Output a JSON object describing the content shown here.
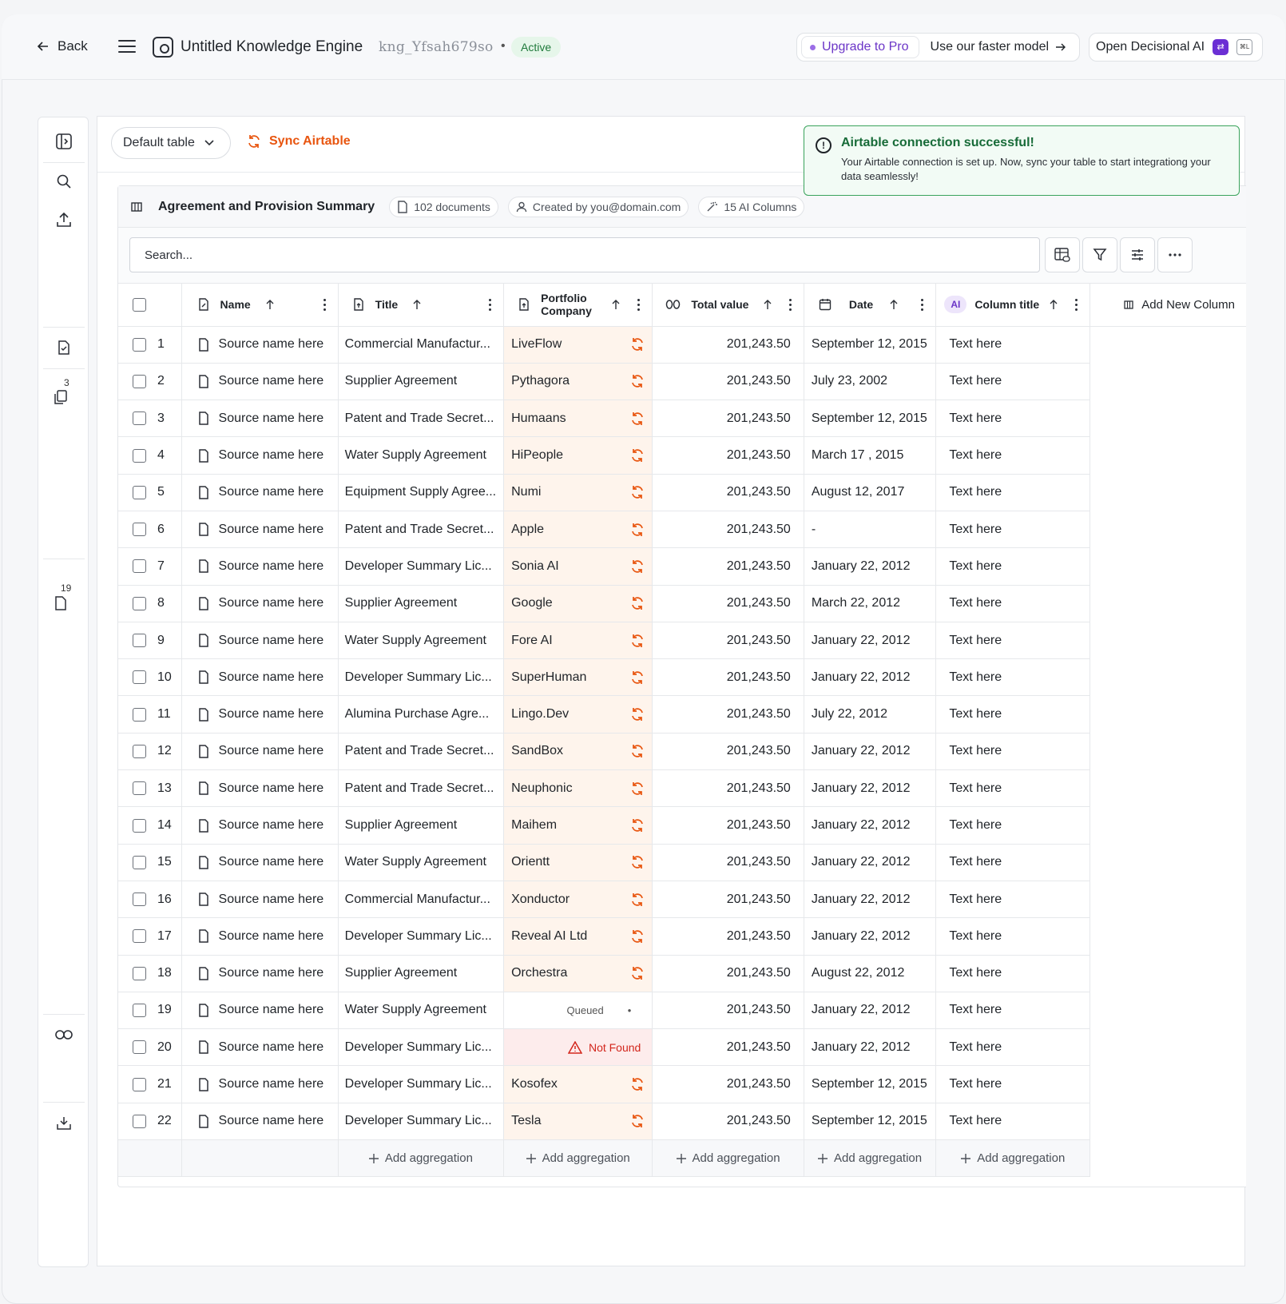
{
  "header": {
    "back_label": "Back",
    "engine_title": "Untitled Knowledge Engine",
    "engine_id": "kng_Yfsah679so",
    "status": "Active",
    "upgrade_label": "Upgrade to Pro",
    "faster_label": "Use our faster model",
    "decisional_label": "Open Decisional AI",
    "shortcut": "⌘L"
  },
  "sidebar": {
    "badge_a": "3",
    "badge_b": "19"
  },
  "toolbar": {
    "table_select": "Default table",
    "sync_label": "Sync Airtable"
  },
  "toast": {
    "title": "Airtable connection successful!",
    "body": "Your Airtable connection is set up. Now, sync your table to start integrationg your data seamlessly!"
  },
  "card": {
    "title": "Agreement and Provision Summary",
    "documents": "102 documents",
    "created_by": "Created by you@domain.com",
    "ai_columns": "15 AI Columns",
    "search_placeholder": "Search..."
  },
  "columns": {
    "name": "Name",
    "title": "Title",
    "portfolio": "Portfolio Company",
    "total": "Total value",
    "date": "Date",
    "ai_badge": "AI",
    "column_title": "Column title",
    "add_column": "Add New Column"
  },
  "rows": [
    {
      "n": "1",
      "name": "Source name here",
      "title": "Commercial Manufactur...",
      "company": "LiveFlow",
      "total": "201,243.50",
      "date": "September 12, 2015",
      "text": "Text here"
    },
    {
      "n": "2",
      "name": "Source name here",
      "title": "Supplier Agreement",
      "company": "Pythagora",
      "total": "201,243.50",
      "date": "July 23, 2002",
      "text": "Text here"
    },
    {
      "n": "3",
      "name": "Source name here",
      "title": "Patent and Trade Secret...",
      "company": "Humaans",
      "total": "201,243.50",
      "date": "September 12, 2015",
      "text": "Text here"
    },
    {
      "n": "4",
      "name": "Source name here",
      "title": "Water Supply Agreement",
      "company": "HiPeople",
      "total": "201,243.50",
      "date": "March 17 , 2015",
      "text": "Text here"
    },
    {
      "n": "5",
      "name": "Source name here",
      "title": "Equipment Supply Agree...",
      "company": "Numi",
      "total": "201,243.50",
      "date": "August 12, 2017",
      "text": "Text here"
    },
    {
      "n": "6",
      "name": "Source name here",
      "title": "Patent and Trade Secret...",
      "company": "Apple",
      "total": "201,243.50",
      "date": "-",
      "text": "Text here"
    },
    {
      "n": "7",
      "name": "Source name here",
      "title": "Developer Summary Lic...",
      "company": "Sonia AI",
      "total": "201,243.50",
      "date": "January 22, 2012",
      "text": "Text here"
    },
    {
      "n": "8",
      "name": "Source name here",
      "title": "Supplier Agreement",
      "company": "Google",
      "total": "201,243.50",
      "date": "March 22, 2012",
      "text": "Text here"
    },
    {
      "n": "9",
      "name": "Source name here",
      "title": "Water Supply Agreement",
      "company": "Fore AI",
      "total": "201,243.50",
      "date": "January 22, 2012",
      "text": "Text here"
    },
    {
      "n": "10",
      "name": "Source name here",
      "title": "Developer Summary Lic...",
      "company": "SuperHuman",
      "total": "201,243.50",
      "date": "January 22, 2012",
      "text": "Text here"
    },
    {
      "n": "11",
      "name": "Source name here",
      "title": "Alumina Purchase Agre...",
      "company": "Lingo.Dev",
      "total": "201,243.50",
      "date": "July 22, 2012",
      "text": "Text here"
    },
    {
      "n": "12",
      "name": "Source name here",
      "title": "Patent and Trade Secret...",
      "company": "SandBox",
      "total": "201,243.50",
      "date": "January 22, 2012",
      "text": "Text here"
    },
    {
      "n": "13",
      "name": "Source name here",
      "title": "Patent and Trade Secret...",
      "company": "Neuphonic",
      "total": "201,243.50",
      "date": "January 22, 2012",
      "text": "Text here"
    },
    {
      "n": "14",
      "name": "Source name here",
      "title": "Supplier Agreement",
      "company": "Maihem",
      "total": "201,243.50",
      "date": "January 22, 2012",
      "text": "Text here"
    },
    {
      "n": "15",
      "name": "Source name here",
      "title": "Water Supply Agreement",
      "company": "Orientt",
      "total": "201,243.50",
      "date": "January 22, 2012",
      "text": "Text here"
    },
    {
      "n": "16",
      "name": "Source name here",
      "title": "Commercial Manufactur...",
      "company": "Xonductor",
      "total": "201,243.50",
      "date": "January 22, 2012",
      "text": "Text here"
    },
    {
      "n": "17",
      "name": "Source name here",
      "title": "Developer Summary Lic...",
      "company": "Reveal AI Ltd",
      "total": "201,243.50",
      "date": "January 22, 2012",
      "text": "Text here"
    },
    {
      "n": "18",
      "name": "Source name here",
      "title": "Supplier Agreement",
      "company": "Orchestra",
      "total": "201,243.50",
      "date": "August 22, 2012",
      "text": "Text here"
    },
    {
      "n": "19",
      "name": "Source name here",
      "title": "Water Supply Agreement",
      "company": "",
      "status": "Queued",
      "total": "201,243.50",
      "date": "January 22, 2012",
      "text": "Text here"
    },
    {
      "n": "20",
      "name": "Source name here",
      "title": "Developer Summary Lic...",
      "company": "",
      "status": "Not Found",
      "total": "201,243.50",
      "date": "January 22, 2012",
      "text": "Text here"
    },
    {
      "n": "21",
      "name": "Source name here",
      "title": "Developer Summary Lic...",
      "company": "Kosofex",
      "total": "201,243.50",
      "date": "September 12, 2015",
      "text": "Text here"
    },
    {
      "n": "22",
      "name": "Source name here",
      "title": "Developer Summary Lic...",
      "company": "Tesla",
      "total": "201,243.50",
      "date": "September 12, 2015",
      "text": "Text here"
    }
  ],
  "aggregation_label": "Add aggregation",
  "colors": {
    "accent_orange": "#e8550f",
    "success_green": "#3aa35c",
    "purple": "#6b35c7",
    "error_red": "#d3261c"
  }
}
